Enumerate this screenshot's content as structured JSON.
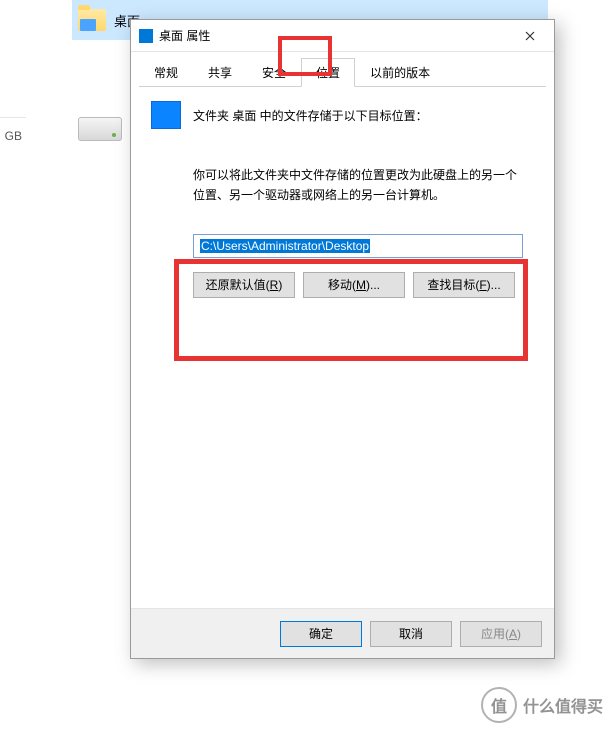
{
  "explorer": {
    "folder_label": "桌面",
    "left_fragment": "GB"
  },
  "dialog": {
    "title": "桌面 属性",
    "tabs": {
      "general": "常规",
      "share": "共享",
      "security": "安全",
      "location": "位置",
      "previous": "以前的版本"
    },
    "info_line": "文件夹 桌面 中的文件存储于以下目标位置：",
    "desc_line": "你可以将此文件夹中文件存储的位置更改为此硬盘上的另一个位置、另一个驱动器或网络上的另一台计算机。",
    "path_value": "C:\\Users\\Administrator\\Desktop",
    "buttons": {
      "restore_pre": "还原默认值(",
      "restore_u": "R",
      "restore_post": ")",
      "move_pre": "移动(",
      "move_u": "M",
      "move_post": ")...",
      "find_pre": "查找目标(",
      "find_u": "F",
      "find_post": ")..."
    },
    "footer": {
      "ok": "确定",
      "cancel": "取消",
      "apply_pre": "应用(",
      "apply_u": "A",
      "apply_post": ")"
    }
  },
  "watermark": {
    "circle": "值",
    "text": "什么值得买"
  }
}
